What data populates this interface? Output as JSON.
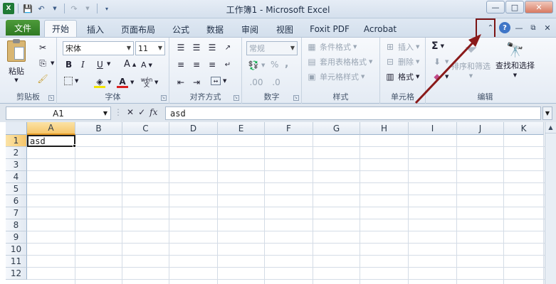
{
  "window": {
    "title": "工作簿1 - Microsoft Excel",
    "controls": [
      "—",
      "□",
      "✕"
    ]
  },
  "tabs": {
    "file": "文件",
    "items": [
      "开始",
      "插入",
      "页面布局",
      "公式",
      "数据",
      "审阅",
      "视图",
      "Foxit PDF",
      "Acrobat"
    ],
    "active": "开始"
  },
  "ribbon": {
    "clipboard": {
      "label": "剪贴板",
      "paste": "粘贴"
    },
    "font": {
      "label": "字体",
      "name": "宋体",
      "size": "11",
      "bold": "B",
      "italic": "I",
      "underline": "U",
      "grow": "A",
      "shrink": "A",
      "color_letter": "A",
      "wen": "wén"
    },
    "alignment": {
      "label": "对齐方式"
    },
    "number": {
      "label": "数字",
      "format": "常规",
      "percent": "%",
      "comma": ","
    },
    "styles": {
      "label": "样式",
      "conditional": "条件格式",
      "table": "套用表格格式",
      "cell": "单元格样式"
    },
    "cells": {
      "label": "单元格",
      "insert": "插入",
      "delete": "删除",
      "format": "格式"
    },
    "editing": {
      "label": "编辑",
      "sort": "排序和筛选",
      "find": "查找和选择"
    }
  },
  "formula_bar": {
    "name_box": "A1",
    "fx": "fx",
    "value": "asd"
  },
  "sheet": {
    "columns": [
      "A",
      "B",
      "C",
      "D",
      "E",
      "F",
      "G",
      "H",
      "I",
      "J",
      "K"
    ],
    "rows": [
      "1",
      "2",
      "3",
      "4",
      "5",
      "6",
      "7",
      "8",
      "9",
      "10",
      "11",
      "12"
    ],
    "active_cell_value": "asd"
  },
  "colors": {
    "file_tab": "#2f7a24",
    "highlight": "#7b1414",
    "selected_header": "#f6c66b"
  }
}
